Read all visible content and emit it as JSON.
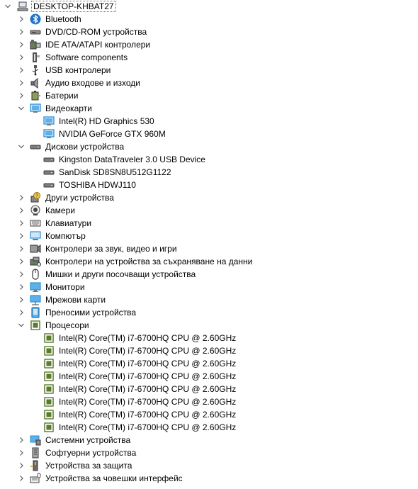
{
  "computer_name": "DESKTOP-KHBAT27",
  "nodes": [
    {
      "label": "Bluetooth",
      "icon": "bluetooth-icon",
      "level": 1,
      "expanded": false
    },
    {
      "label": "DVD/CD-ROM устройства",
      "icon": "dvd-drive-icon",
      "level": 1,
      "expanded": false
    },
    {
      "label": "IDE ATA/ATAPI контролери",
      "icon": "ide-controller-icon",
      "level": 1,
      "expanded": false
    },
    {
      "label": "Software components",
      "icon": "software-component-icon",
      "level": 1,
      "expanded": false
    },
    {
      "label": "USB контролери",
      "icon": "usb-icon",
      "level": 1,
      "expanded": false
    },
    {
      "label": "Аудио входове и изходи",
      "icon": "speaker-icon",
      "level": 1,
      "expanded": false
    },
    {
      "label": "Батерии",
      "icon": "battery-icon",
      "level": 1,
      "expanded": false
    },
    {
      "label": "Видеокарти",
      "icon": "display-adapter-icon",
      "level": 1,
      "expanded": true
    },
    {
      "label": "Intel(R) HD Graphics 530",
      "icon": "display-adapter-icon",
      "level": 2
    },
    {
      "label": "NVIDIA GeForce GTX 960M",
      "icon": "display-adapter-icon",
      "level": 2
    },
    {
      "label": "Дискови устройства",
      "icon": "disk-drive-icon",
      "level": 1,
      "expanded": true
    },
    {
      "label": "Kingston DataTraveler 3.0 USB Device",
      "icon": "disk-drive-icon",
      "level": 2
    },
    {
      "label": "SanDisk SD8SN8U512G1122",
      "icon": "disk-drive-icon",
      "level": 2
    },
    {
      "label": "TOSHIBA HDWJ110",
      "icon": "disk-drive-icon",
      "level": 2
    },
    {
      "label": "Други устройства",
      "icon": "unknown-device-icon",
      "level": 1,
      "expanded": false
    },
    {
      "label": "Камери",
      "icon": "camera-icon",
      "level": 1,
      "expanded": false
    },
    {
      "label": "Клавиатури",
      "icon": "keyboard-icon",
      "level": 1,
      "expanded": false
    },
    {
      "label": "Компютър",
      "icon": "computer-icon",
      "level": 1,
      "expanded": false
    },
    {
      "label": "Контролери за звук, видео и игри",
      "icon": "sound-controller-icon",
      "level": 1,
      "expanded": false
    },
    {
      "label": "Контролери на устройства за съхраняване на данни",
      "icon": "storage-controller-icon",
      "level": 1,
      "expanded": false
    },
    {
      "label": "Мишки и други посочващи устройства",
      "icon": "mouse-icon",
      "level": 1,
      "expanded": false
    },
    {
      "label": "Монитори",
      "icon": "monitor-icon",
      "level": 1,
      "expanded": false
    },
    {
      "label": "Мрежови карти",
      "icon": "network-adapter-icon",
      "level": 1,
      "expanded": false
    },
    {
      "label": "Преносими устройства",
      "icon": "portable-device-icon",
      "level": 1,
      "expanded": false
    },
    {
      "label": "Процесори",
      "icon": "processor-icon",
      "level": 1,
      "expanded": true
    },
    {
      "label": "Intel(R) Core(TM) i7-6700HQ CPU @ 2.60GHz",
      "icon": "processor-icon",
      "level": 2
    },
    {
      "label": "Intel(R) Core(TM) i7-6700HQ CPU @ 2.60GHz",
      "icon": "processor-icon",
      "level": 2
    },
    {
      "label": "Intel(R) Core(TM) i7-6700HQ CPU @ 2.60GHz",
      "icon": "processor-icon",
      "level": 2
    },
    {
      "label": "Intel(R) Core(TM) i7-6700HQ CPU @ 2.60GHz",
      "icon": "processor-icon",
      "level": 2
    },
    {
      "label": "Intel(R) Core(TM) i7-6700HQ CPU @ 2.60GHz",
      "icon": "processor-icon",
      "level": 2
    },
    {
      "label": "Intel(R) Core(TM) i7-6700HQ CPU @ 2.60GHz",
      "icon": "processor-icon",
      "level": 2
    },
    {
      "label": "Intel(R) Core(TM) i7-6700HQ CPU @ 2.60GHz",
      "icon": "processor-icon",
      "level": 2
    },
    {
      "label": "Intel(R) Core(TM) i7-6700HQ CPU @ 2.60GHz",
      "icon": "processor-icon",
      "level": 2
    },
    {
      "label": "Системни устройства",
      "icon": "system-device-icon",
      "level": 1,
      "expanded": false
    },
    {
      "label": "Софтуерни устройства",
      "icon": "software-device-icon",
      "level": 1,
      "expanded": false
    },
    {
      "label": "Устройства за защита",
      "icon": "security-device-icon",
      "level": 1,
      "expanded": false
    },
    {
      "label": "Устройства за човешки интерфейс",
      "icon": "hid-icon",
      "level": 1,
      "expanded": false
    }
  ],
  "colors": {
    "chevron": "#5a5a5a",
    "selection_border": "#6c6c6c",
    "monitor_blue": "#2b8fd6",
    "chip_green": "#5a7a2e"
  }
}
